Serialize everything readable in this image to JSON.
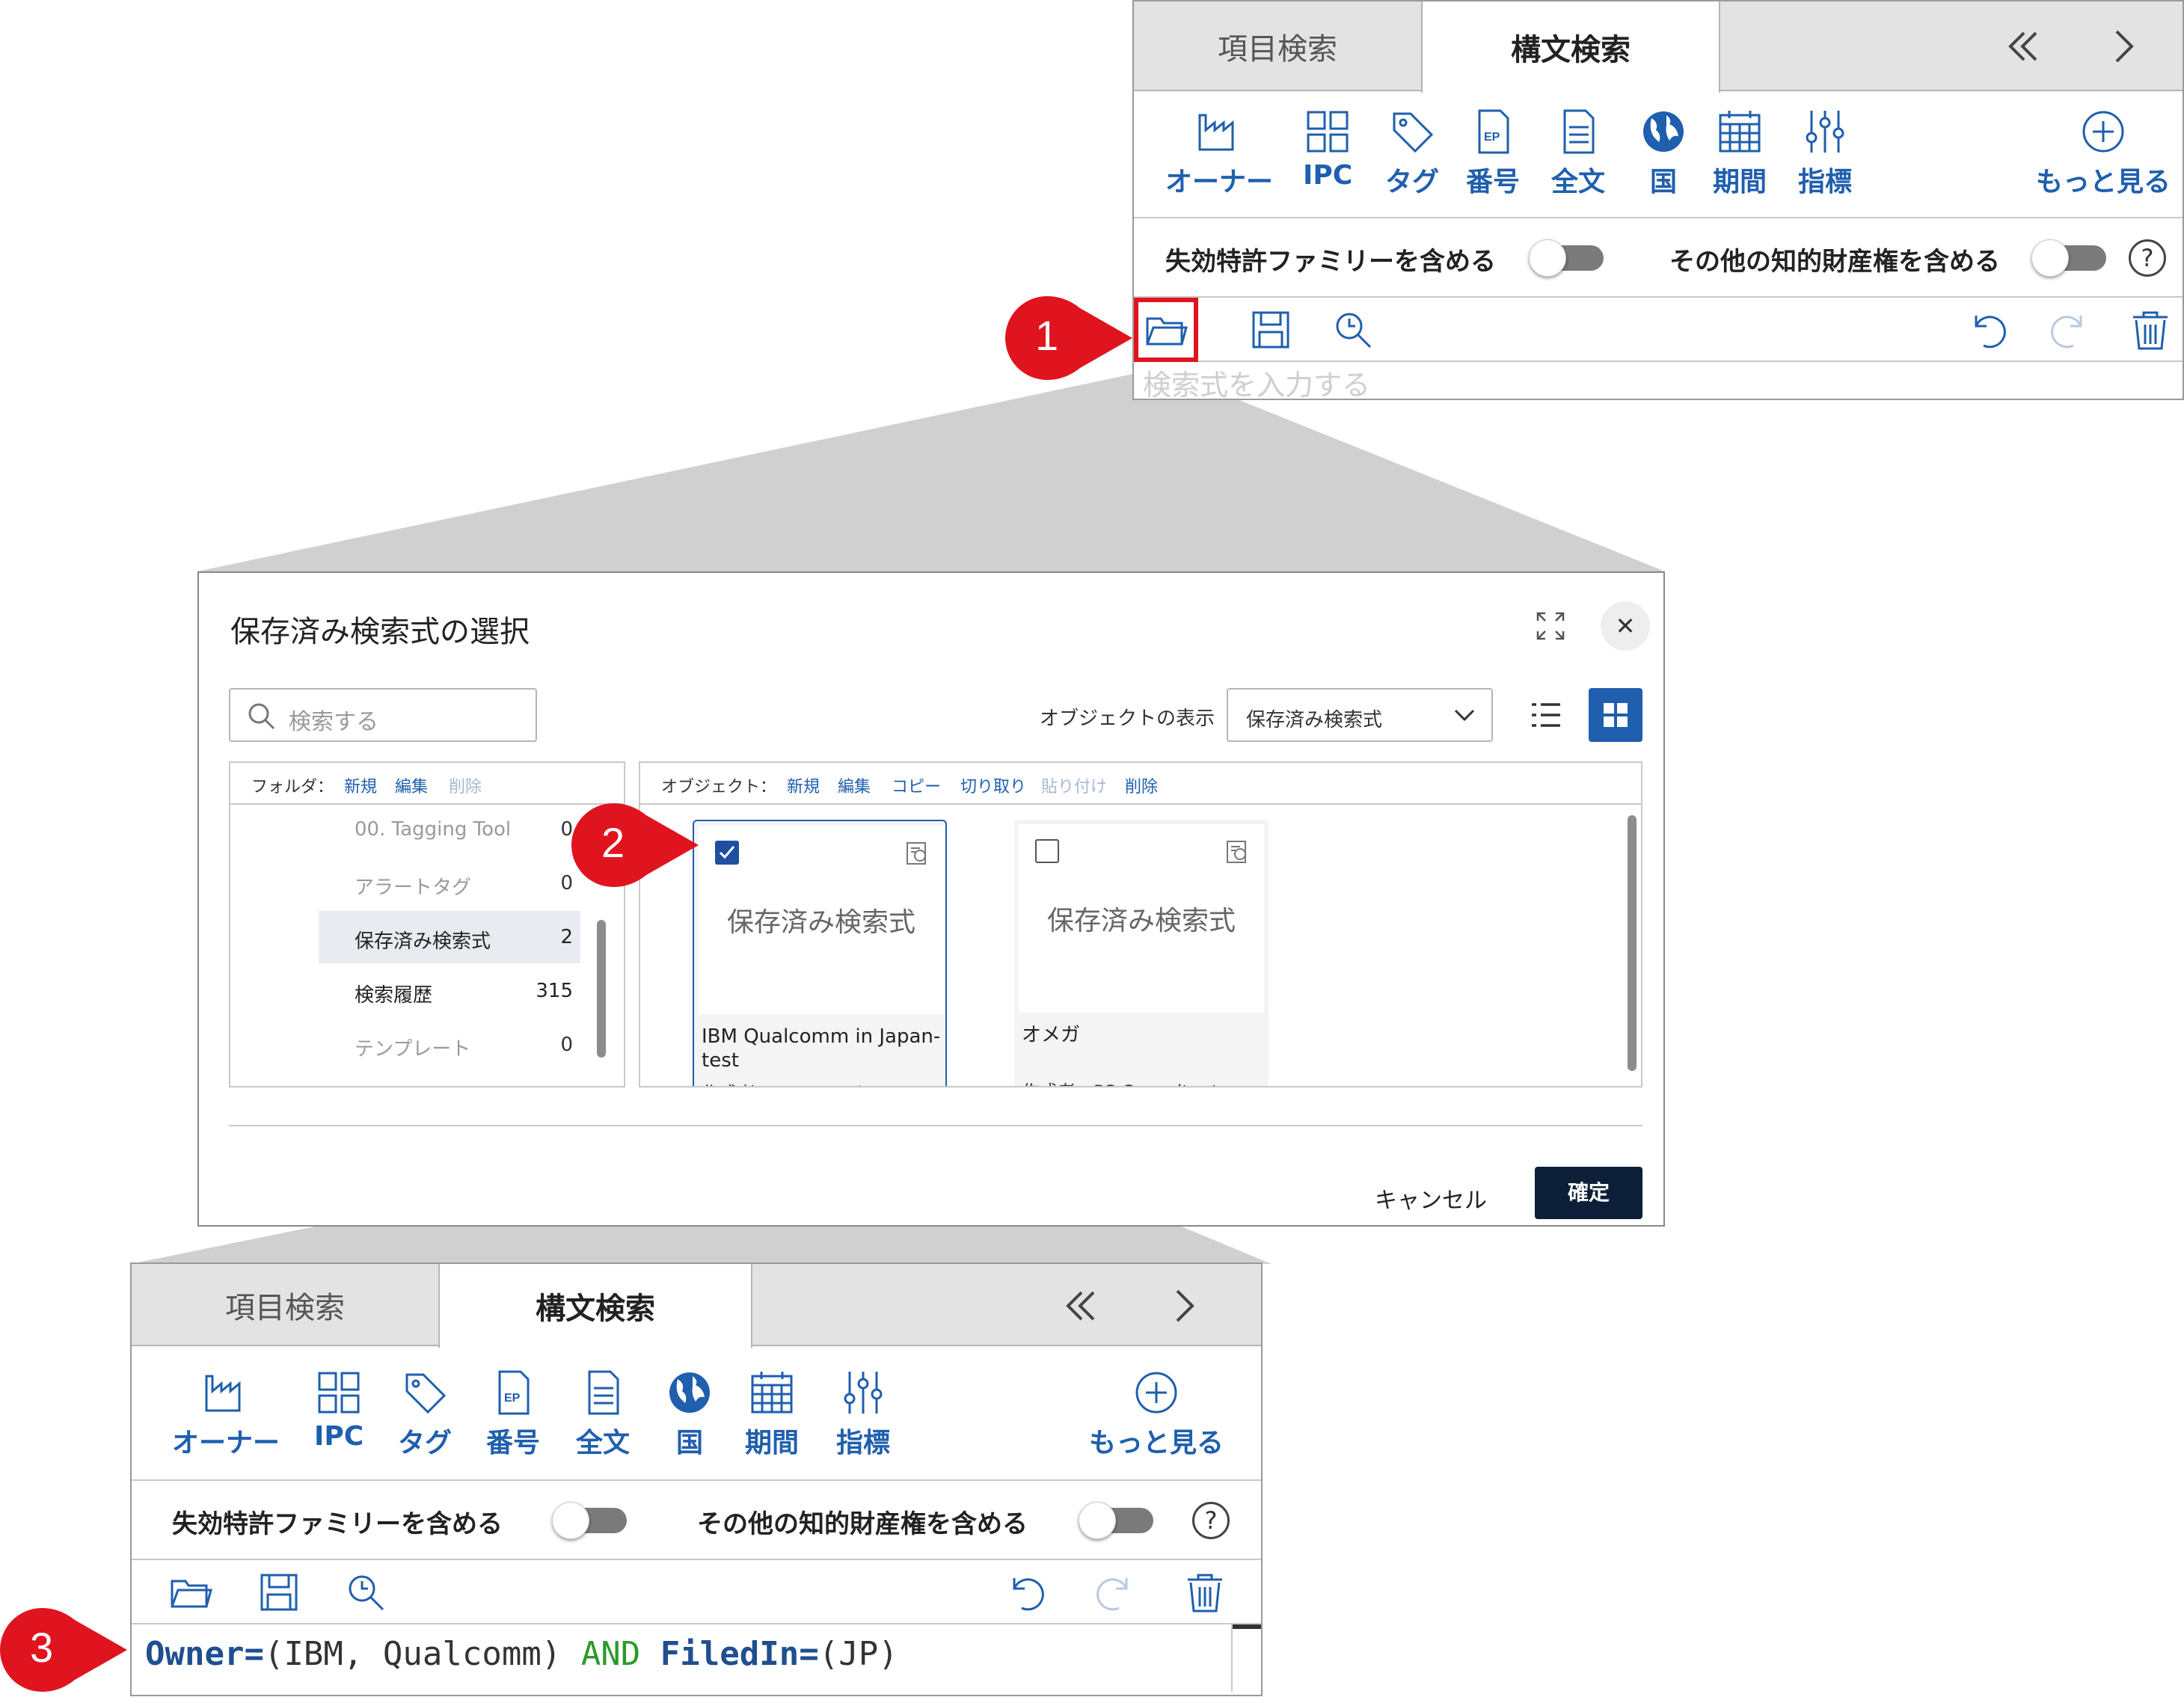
{
  "panel": {
    "tabs": [
      "項目検索",
      "構文検索"
    ],
    "tools": [
      "オーナー",
      "IPC",
      "タグ",
      "番号",
      "全文",
      "国",
      "期間",
      "指標"
    ],
    "more": "もっと見る",
    "ep_badge": "EP",
    "options": [
      "失効特許ファミリーを含める",
      "その他の知的財産権を含める"
    ],
    "help": "?",
    "query_placeholder": "検索式を入力する"
  },
  "callouts": [
    "1",
    "2",
    "3"
  ],
  "dialog": {
    "title": "保存済み検索式の選択",
    "close": "✕",
    "search_placeholder": "検索する",
    "object_display_label": "オブジェクトの表示",
    "object_display_value": "保存済み検索式",
    "folder_pane": {
      "label": "フォルダ：",
      "actions": [
        "新規",
        "編集",
        "削除"
      ],
      "folders": [
        {
          "name": "00. Tagging Tool",
          "count": "0"
        },
        {
          "name": "アラートタグ",
          "count": "0"
        },
        {
          "name": "保存済み検索式",
          "count": "2"
        },
        {
          "name": "検索履歴",
          "count": "315"
        },
        {
          "name": "テンプレート",
          "count": "0"
        }
      ]
    },
    "object_pane": {
      "label": "オブジェクト：",
      "actions": [
        "新規",
        "編集",
        "コピー",
        "切り取り",
        "貼り付け",
        "削除"
      ],
      "cards": [
        {
          "thumb": "保存済み検索式",
          "title": "IBM Qualcomm in Japan-test",
          "author": "作成者：PS Consultant",
          "checked": true
        },
        {
          "thumb": "保存済み検索式",
          "title": "オメガ",
          "author": "作成者：PS Consultant",
          "checked": false
        }
      ]
    },
    "cancel": "キャンセル",
    "confirm": "確定"
  },
  "query": {
    "field1": "Owner=",
    "val1": "(IBM, Qualcomm)",
    "op": "AND",
    "field2": "FiledIn=",
    "val2": "(JP)"
  },
  "colors": {
    "accent": "#1f5fae",
    "callout": "#e0141e",
    "dark_button": "#0d1f38",
    "query_field": "#1f4f8f",
    "query_operator": "#2a9a2a"
  }
}
